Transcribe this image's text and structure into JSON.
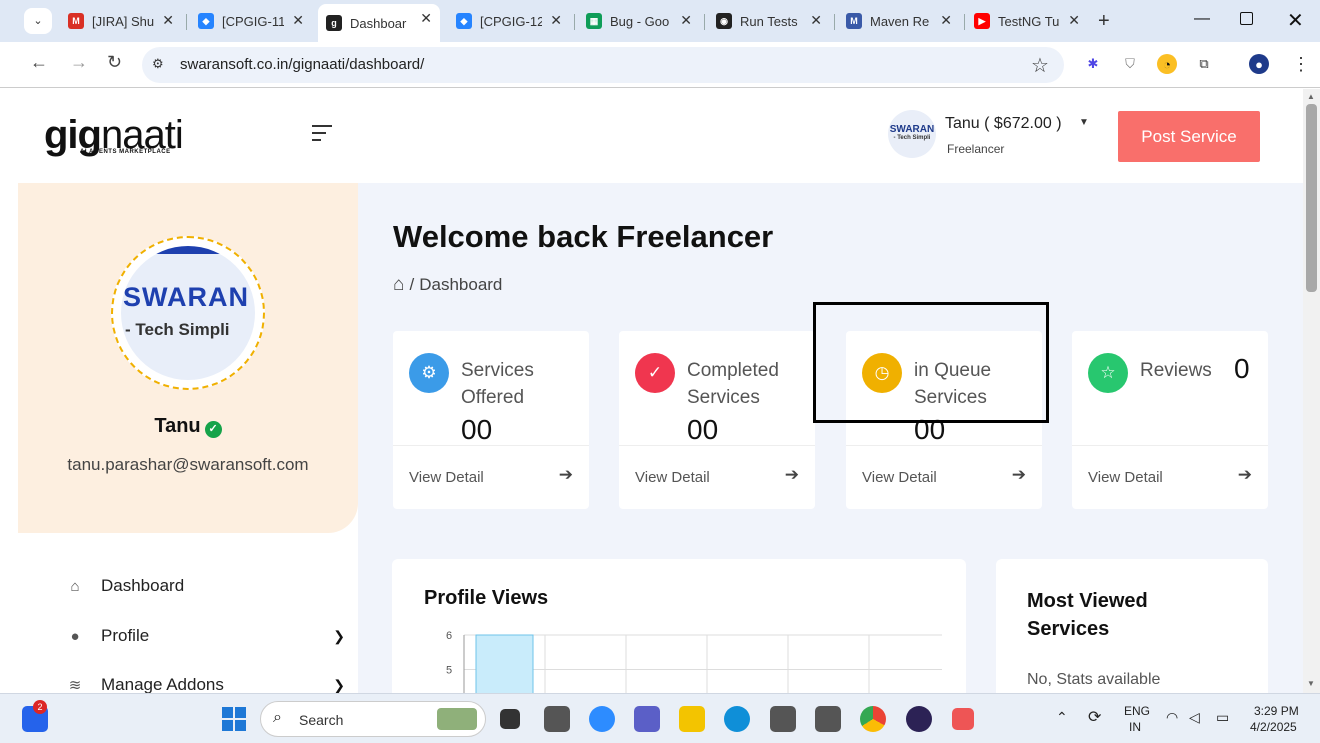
{
  "browser": {
    "tabs": [
      {
        "label": "[JIRA] Shu",
        "favicon": "gmail-icon",
        "color": "#d93025"
      },
      {
        "label": "[CPGIG-11",
        "favicon": "jira-icon",
        "color": "#2684ff"
      },
      {
        "label": "Dashboar",
        "favicon": "gignaati-icon",
        "color": "#222222",
        "active": true
      },
      {
        "label": "[CPGIG-12",
        "favicon": "jira-icon",
        "color": "#2684ff"
      },
      {
        "label": "Bug - Goo",
        "favicon": "sheets-icon",
        "color": "#0f9d58"
      },
      {
        "label": "Run Tests",
        "favicon": "github-icon",
        "color": "#222222"
      },
      {
        "label": "Maven Re",
        "favicon": "maven-icon",
        "color": "#3a5aa8"
      },
      {
        "label": "TestNG Tu",
        "favicon": "youtube-icon",
        "color": "#ff0000"
      }
    ],
    "url": "swaransoft.co.in/gignaati/dashboard/"
  },
  "header": {
    "logo_main": "gig",
    "logo_thin": "naati",
    "logo_tagline": "AI AGENTS MARKETPLACE",
    "avatar_text": "SWARAN",
    "avatar_sub": "- Tech Simpli",
    "user_name": "Tanu ( $672.00 )",
    "user_role": "Freelancer",
    "post_service_label": "Post Service"
  },
  "sidebar": {
    "avatar_text": "SWARAN",
    "avatar_sub": "- Tech Simpli",
    "name": "Tanu",
    "email": "tanu.parashar@swaransoft.com",
    "menu": [
      {
        "label": "Dashboard",
        "icon": "home-icon"
      },
      {
        "label": "Profile",
        "icon": "user-icon"
      },
      {
        "label": "Manage Addons",
        "icon": "layers-icon"
      }
    ]
  },
  "main": {
    "welcome": "Welcome back Freelancer",
    "breadcrumb": "Dashboard",
    "stats": [
      {
        "label": "Services Offered",
        "value": "00",
        "link": "View Detail",
        "icon": "gear-icon",
        "color": "#3b9be8"
      },
      {
        "label": "Completed Services",
        "value": "00",
        "link": "View Detail",
        "icon": "check-icon",
        "color": "#f0364f"
      },
      {
        "label": "in Queue Services",
        "value": "00",
        "link": "View Detail",
        "icon": "clock-icon",
        "color": "#f0b000"
      },
      {
        "label": "Reviews",
        "value": "0",
        "link": "View Detail",
        "icon": "star-icon",
        "color": "#28c76f"
      }
    ],
    "profile_views": {
      "title": "Profile Views"
    },
    "most_viewed": {
      "title": "Most Viewed Services",
      "empty": "No, Stats available"
    }
  },
  "chart_data": {
    "type": "bar",
    "title": "",
    "yticks": [
      5,
      6
    ],
    "ylim": [
      4.8,
      6
    ],
    "categories": [
      "",
      "",
      "",
      "",
      "",
      ""
    ],
    "values": [
      6,
      null,
      null,
      null,
      null,
      null
    ],
    "grid": true
  },
  "taskbar": {
    "search_label": "Search",
    "notification_count": "2",
    "lang_top": "ENG",
    "lang_bottom": "IN",
    "time": "3:29 PM",
    "date": "4/2/2025"
  }
}
